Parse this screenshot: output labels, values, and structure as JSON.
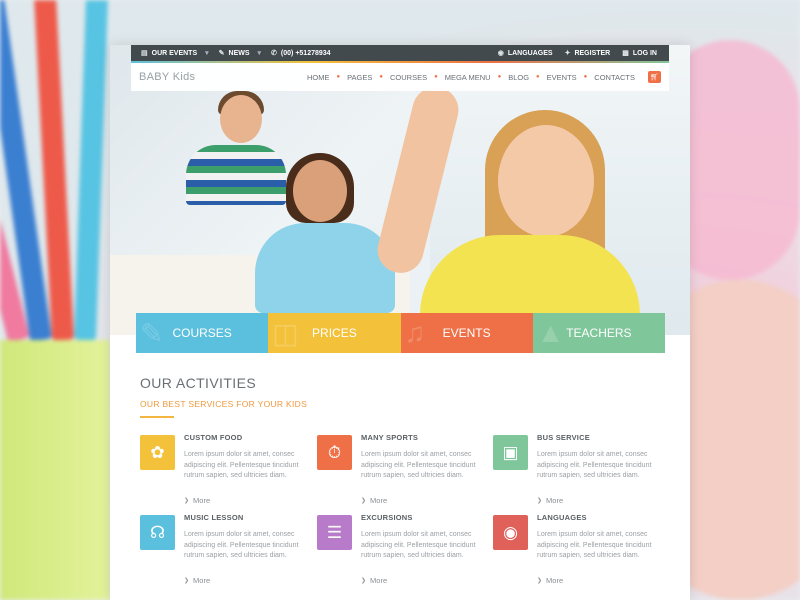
{
  "topbar": {
    "left": [
      {
        "icon": "calendar-icon",
        "label": "OUR EVENTS"
      },
      {
        "icon": "pen-icon",
        "label": "NEWS"
      },
      {
        "icon": "phone-icon",
        "label": "(00) +51278934"
      }
    ],
    "right": [
      {
        "icon": "globe-icon",
        "label": "LANGUAGES"
      },
      {
        "icon": "register-icon",
        "label": "REGISTER"
      },
      {
        "icon": "lock-icon",
        "label": "LOG IN"
      }
    ]
  },
  "nav": {
    "logo": "BABY Kids",
    "items": [
      "HOME",
      "PAGES",
      "COURSES",
      "MEGA MENU",
      "BLOG",
      "EVENTS",
      "CONTACTS"
    ]
  },
  "tiles": [
    {
      "label": "COURSES",
      "color": "#5bc0de",
      "icon": "pencil-icon"
    },
    {
      "label": "PRICES",
      "color": "#f3c13a",
      "icon": "ticket-icon"
    },
    {
      "label": "EVENTS",
      "color": "#ef7046",
      "icon": "music-icon"
    },
    {
      "label": "TEACHERS",
      "color": "#7fc79a",
      "icon": "graduation-cap-icon"
    }
  ],
  "activities": {
    "title": "OUR ACTIVITIES",
    "subtitle": "OUR BEST SERVICES FOR YOUR KIDS",
    "more_label": "More",
    "cards": [
      {
        "title": "CUSTOM FOOD",
        "text": "Lorem ipsum dolor sit amet, consec adipiscing elit. Pellentesque tincidunt rutrum sapien, sed ultricies diam.",
        "color": "#f3c13a",
        "icon": "leaf-icon"
      },
      {
        "title": "MANY SPORTS",
        "text": "Lorem ipsum dolor sit amet, consec adipiscing elit. Pellentesque tincidunt rutrum sapien, sed ultricies diam.",
        "color": "#ef7046",
        "icon": "stopwatch-icon"
      },
      {
        "title": "BUS SERVICE",
        "text": "Lorem ipsum dolor sit amet, consec adipiscing elit. Pellentesque tincidunt rutrum sapien, sed ultricies diam.",
        "color": "#7fc79a",
        "icon": "bus-icon"
      },
      {
        "title": "MUSIC LESSON",
        "text": "Lorem ipsum dolor sit amet, consec adipiscing elit. Pellentesque tincidunt rutrum sapien, sed ultricies diam.",
        "color": "#5bc0de",
        "icon": "headphones-icon"
      },
      {
        "title": "EXCURSIONS",
        "text": "Lorem ipsum dolor sit amet, consec adipiscing elit. Pellentesque tincidunt rutrum sapien, sed ultricies diam.",
        "color": "#b77bc9",
        "icon": "map-icon"
      },
      {
        "title": "LANGUAGES",
        "text": "Lorem ipsum dolor sit amet, consec adipiscing elit. Pellentesque tincidunt rutrum sapien, sed ultricies diam.",
        "color": "#e0605a",
        "icon": "globe-icon"
      }
    ]
  }
}
